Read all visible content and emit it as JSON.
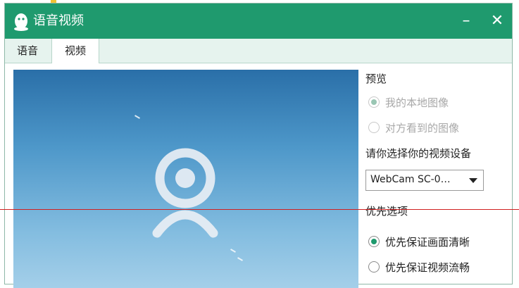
{
  "window": {
    "title": "语音视频",
    "minimize_icon": "minimize-icon",
    "close_icon": "close-icon",
    "app_icon": "qq-penguin-icon"
  },
  "tabs": [
    {
      "label": "语音",
      "selected": false
    },
    {
      "label": "视频",
      "selected": true
    }
  ],
  "preview_section": {
    "label": "预览",
    "options": [
      {
        "label": "我的本地图像",
        "selected": true,
        "disabled": true
      },
      {
        "label": "对方看到的图像",
        "selected": false,
        "disabled": true
      }
    ]
  },
  "device_section": {
    "label": "请你选择你的视频设备",
    "selected_device": "WebCam SC-0…"
  },
  "priority_section": {
    "label": "优先选项",
    "options": [
      {
        "label": "优先保证画面清晰",
        "selected": true
      },
      {
        "label": "优先保证视频流畅",
        "selected": false
      }
    ]
  },
  "colors": {
    "accent": "#1f9a6e",
    "annotation_line": "#d02020"
  }
}
